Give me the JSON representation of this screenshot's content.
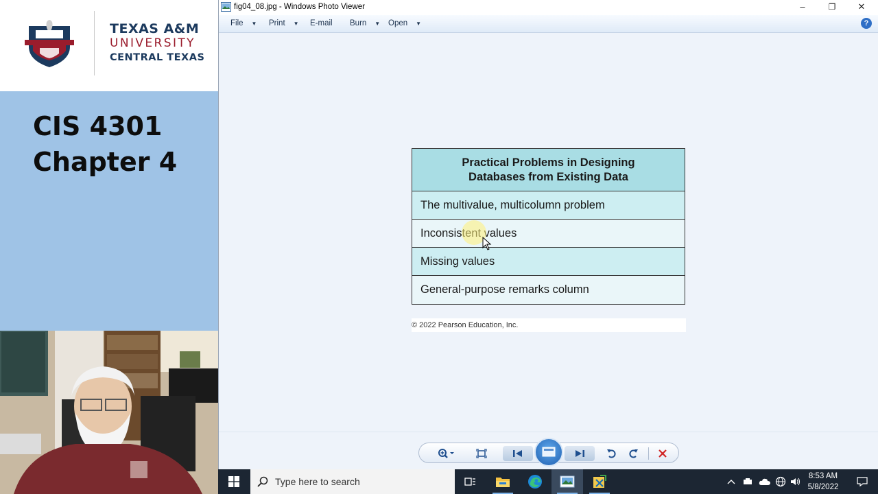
{
  "slide": {
    "logo": {
      "line1": "TEXAS A&M",
      "line2": "UNIVERSITY",
      "line3": "CENTRAL TEXAS"
    },
    "title_line1": "CIS 4301",
    "title_line2": "Chapter 4"
  },
  "viewer": {
    "window_title": "fig04_08.jpg - Windows Photo Viewer",
    "menu": [
      {
        "label": "File",
        "has_caret": true
      },
      {
        "label": "Print",
        "has_caret": true
      },
      {
        "label": "E-mail",
        "has_caret": false
      },
      {
        "label": "Burn",
        "has_caret": true
      },
      {
        "label": "Open",
        "has_caret": true
      }
    ],
    "window_controls": {
      "minimize": "–",
      "restore": "❐",
      "close": "✕"
    },
    "help": "?"
  },
  "figure": {
    "header_line1": "Practical Problems in Designing",
    "header_line2": "Databases from Existing Data",
    "rows": [
      "The multivalue, multicolumn problem",
      "Inconsistent values",
      "Missing values",
      "General-purpose remarks column"
    ],
    "copyright": "© 2022 Pearson Education, Inc.",
    "colors": {
      "header": "#a9dde4",
      "row_tint": "#cdeef2",
      "row_plain": "#eaf6f9"
    }
  },
  "taskbar": {
    "search_placeholder": "Type here to search",
    "time": "8:53 AM",
    "date": "5/8/2022"
  },
  "colors": {
    "slide_bg": "#9fc3e6",
    "brand_maroon": "#9a1c2c",
    "brand_navy": "#1c3a5e",
    "viewer_bg": "#eef3fa",
    "taskbar_bg": "#1c2633"
  }
}
